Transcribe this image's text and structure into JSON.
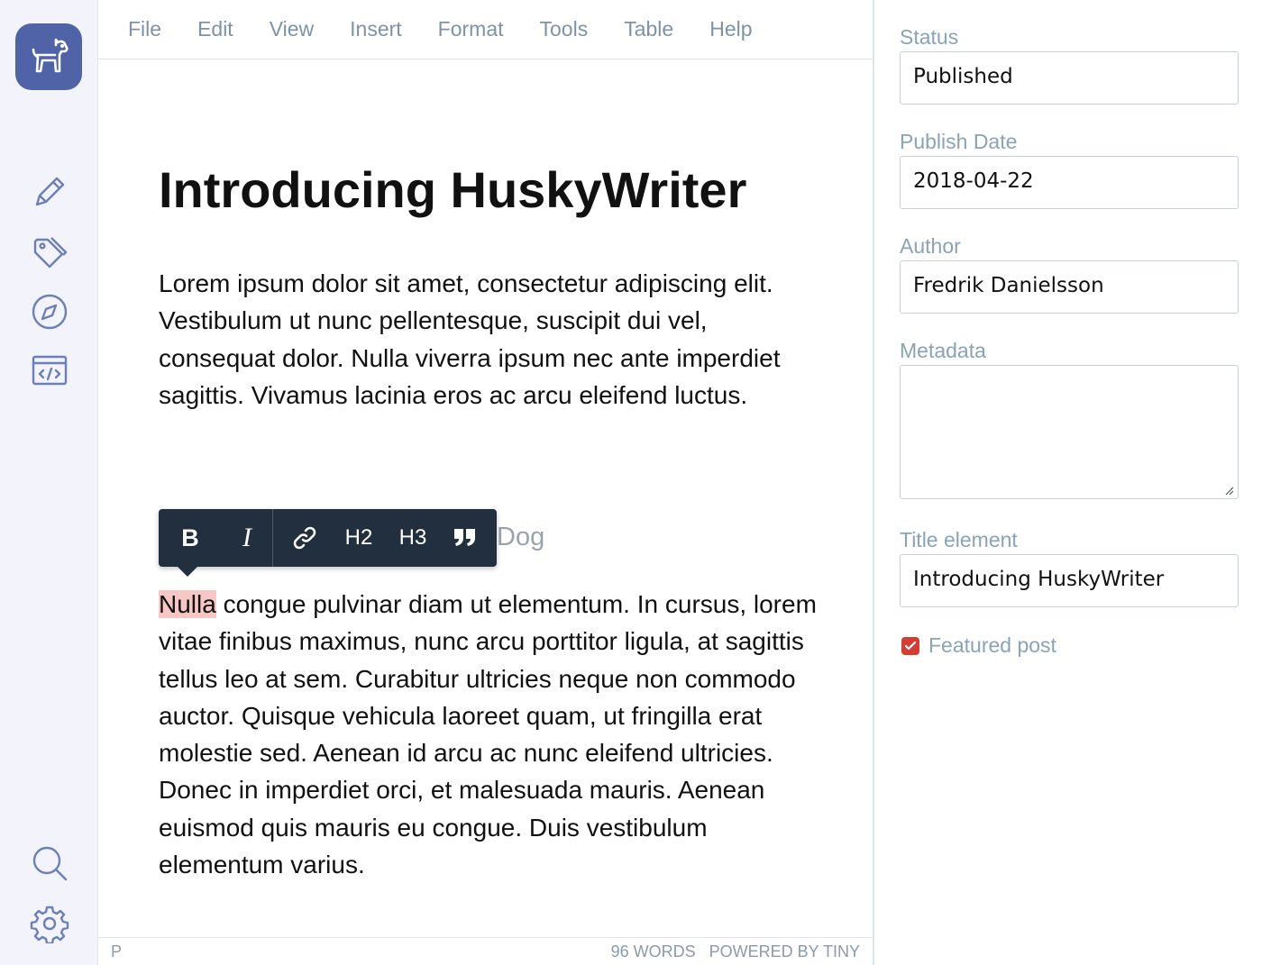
{
  "sidebar": {
    "logo": "dog-logo-icon",
    "items": [
      {
        "icon": "pencil-icon",
        "name": "edit"
      },
      {
        "icon": "tag-icon",
        "name": "tags"
      },
      {
        "icon": "compass-icon",
        "name": "explore"
      },
      {
        "icon": "code-icon",
        "name": "code"
      }
    ],
    "bottom": [
      {
        "icon": "search-icon",
        "name": "search"
      },
      {
        "icon": "gear-icon",
        "name": "settings"
      }
    ]
  },
  "menubar": [
    "File",
    "Edit",
    "View",
    "Insert",
    "Format",
    "Tools",
    "Table",
    "Help"
  ],
  "document": {
    "title": "Introducing HuskyWriter",
    "paragraph1": "Lorem ipsum dolor sit amet, consectetur adipiscing elit. Vestibulum ut nunc pellentesque, suscipit dui vel, consequat dolor. Nulla viverra ipsum nec ante imperdiet sagittis. Vivamus lacinia eros ac arcu eleifend luctus.",
    "heading_visible_fragment": "Dog",
    "paragraph2_highlight": "Nulla",
    "paragraph2_rest": " congue pulvinar diam ut elementum. In cursus, lorem vitae finibus maximus, nunc arcu porttitor ligula, at sagittis tellus leo at sem. Curabitur ultricies neque non commodo auctor. Quisque vehicula laoreet quam, ut fringilla erat molestie sed. Aenean id arcu ac nunc eleifend ultricies. Donec in imperdiet orci, et malesuada mauris. Aenean euismod quis mauris eu congue. Duis vestibulum elementum varius."
  },
  "quick_toolbar": {
    "bold": "B",
    "italic": "I",
    "link": "link-icon",
    "h2": "H2",
    "h3": "H3",
    "quote": "quote-icon"
  },
  "statusbar": {
    "path": "P",
    "words": "96 WORDS",
    "powered": "POWERED BY TINY"
  },
  "panel": {
    "status": {
      "label": "Status",
      "value": "Published"
    },
    "publish_date": {
      "label": "Publish Date",
      "value": "2018-04-22"
    },
    "author": {
      "label": "Author",
      "value": "Fredrik Danielsson"
    },
    "metadata": {
      "label": "Metadata",
      "value": ""
    },
    "title_element": {
      "label": "Title element",
      "value": "Introducing HuskyWriter"
    },
    "featured": {
      "label": "Featured post",
      "checked": true
    }
  },
  "colors": {
    "accent": "#4f63a6",
    "toolbar": "#222f3e",
    "checkbox": "#d33d36",
    "highlight": "#f7c7c5",
    "muted_text": "#8aa3b6"
  }
}
